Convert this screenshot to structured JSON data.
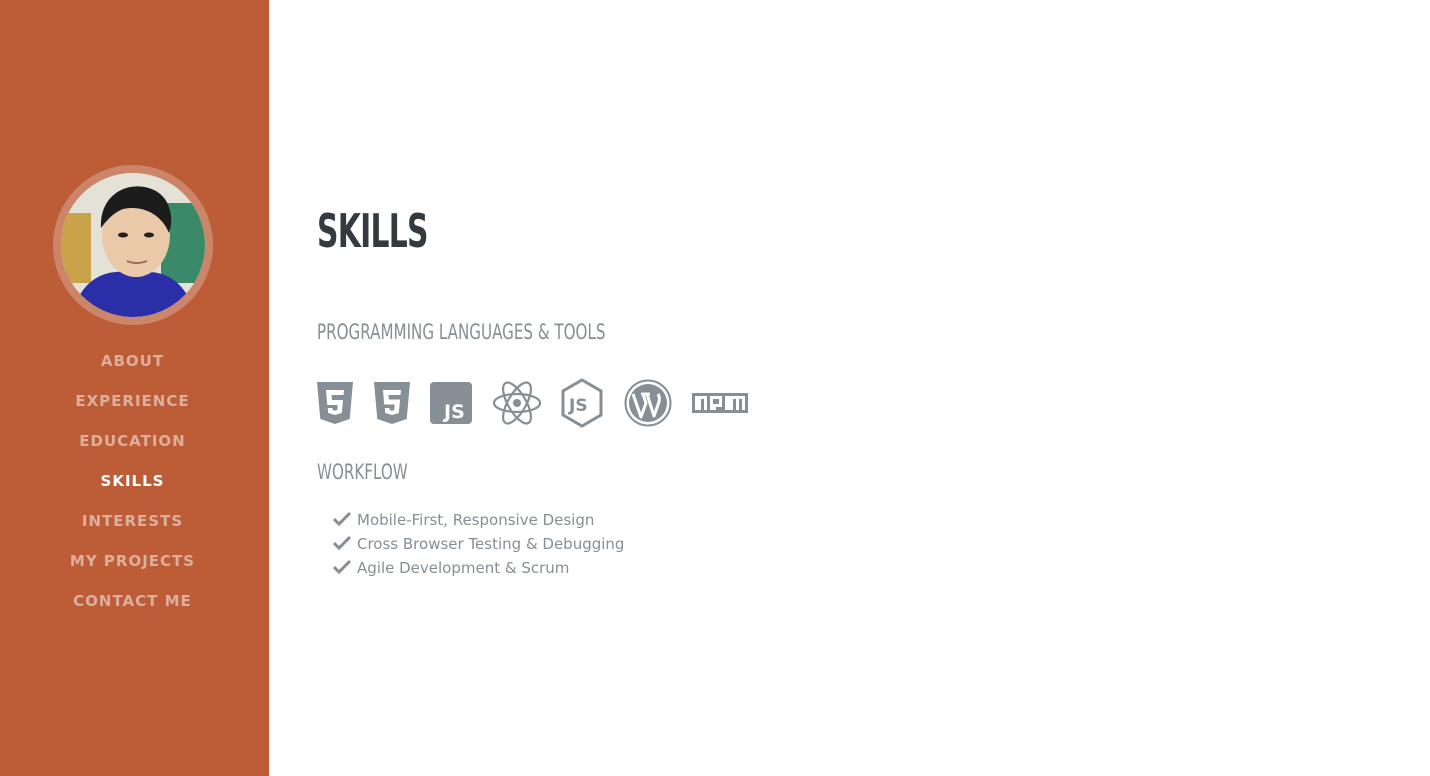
{
  "sidebar": {
    "nav": [
      {
        "label": "ABOUT"
      },
      {
        "label": "EXPERIENCE"
      },
      {
        "label": "EDUCATION"
      },
      {
        "label": "SKILLS",
        "active": true
      },
      {
        "label": "INTERESTS"
      },
      {
        "label": "MY PROJECTS"
      },
      {
        "label": "CONTACT ME"
      }
    ]
  },
  "main": {
    "title": "SKILLS",
    "languages_heading": "PROGRAMMING LANGUAGES & TOOLS",
    "tool_icons": [
      "html5-icon",
      "css3-icon",
      "javascript-icon",
      "react-icon",
      "nodejs-icon",
      "wordpress-icon",
      "npm-icon"
    ],
    "workflow_heading": "WORKFLOW",
    "workflow_items": [
      "Mobile-First, Responsive Design",
      "Cross Browser Testing & Debugging",
      "Agile Development & Scrum"
    ]
  },
  "colors": {
    "sidebar_bg": "#bd5d38",
    "heading": "#343a40",
    "muted": "#868e96"
  }
}
